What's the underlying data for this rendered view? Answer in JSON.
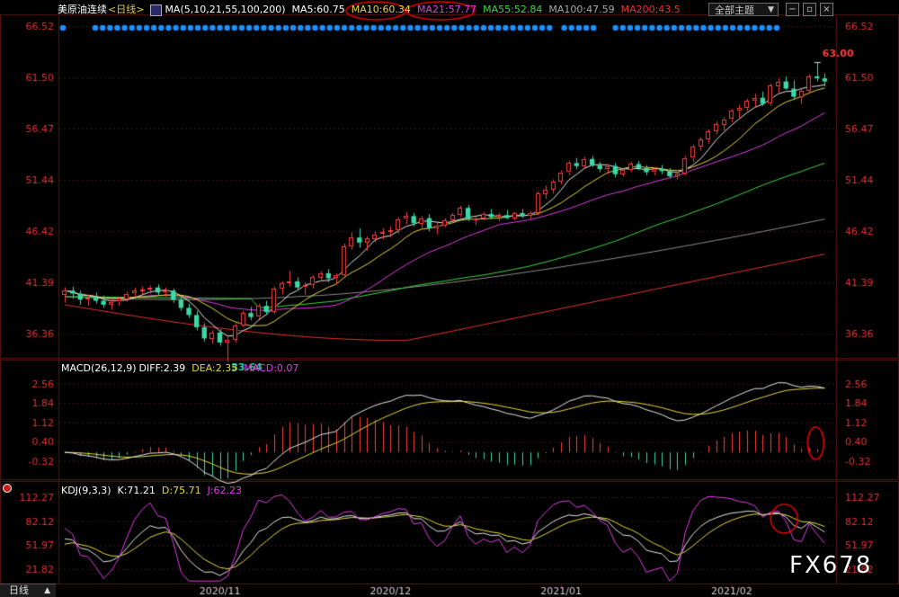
{
  "header": {
    "symbol": "美原油连续",
    "period": "<日线>",
    "ma_group": "MA(5,10,21,55,100,200)",
    "ma5": "MA5:60.75",
    "ma10": "MA10:60.34",
    "ma21": "MA21:57.77",
    "ma55": "MA55:52.84",
    "ma100": "MA100:47.59",
    "ma200": "MA200:43.5",
    "theme_label": "全部主题",
    "theme_arrow": "▼"
  },
  "macd_header": {
    "name": "MACD(26,12,9)",
    "diff": "DIFF:2.39",
    "dea": "DEA:2.35",
    "macd": "MACD:0.07"
  },
  "kdj_header": {
    "name": "KDJ(9,3,3)",
    "k": "K:71.21",
    "d": "D:75.71",
    "j": "J:62.23"
  },
  "footer": {
    "period_tab": "日线",
    "period_arrow": "▲"
  },
  "watermark": "FX678",
  "colors": {
    "up": "#ff3c3c",
    "down": "#3cd8a8",
    "ma5": "#e6e6e6",
    "ma10": "#e6d83c",
    "ma21": "#e03ce6",
    "ma55": "#3cd83c",
    "ma100": "#8c8c8c",
    "ma200": "#e6322e",
    "axis_text": "#e6322e",
    "annotation": "#e00000"
  },
  "chart_data": [
    {
      "type": "candlestick",
      "name": "美原油连续",
      "x_ticks": [
        "2020/11",
        "2020/12",
        "2021/01",
        "2021/02"
      ],
      "y_ticks": [
        "66.52",
        "61.50",
        "56.47",
        "51.44",
        "46.42",
        "41.39",
        "36.36"
      ],
      "ylim": [
        34.0,
        67.5
      ],
      "high_label": "63.00",
      "low_label": "33.64",
      "candles": [
        [
          40.2,
          40.9,
          39.4,
          40.6
        ],
        [
          40.6,
          41.0,
          39.8,
          40.3
        ],
        [
          40.3,
          40.6,
          39.2,
          39.7
        ],
        [
          39.7,
          40.2,
          39.1,
          39.9
        ],
        [
          39.9,
          40.4,
          39.3,
          39.6
        ],
        [
          39.6,
          40.1,
          38.9,
          39.2
        ],
        [
          39.2,
          39.8,
          38.7,
          39.5
        ],
        [
          39.5,
          40.0,
          39.1,
          39.8
        ],
        [
          39.8,
          40.5,
          39.5,
          40.3
        ],
        [
          40.3,
          40.9,
          40.0,
          40.6
        ],
        [
          40.6,
          41.0,
          40.2,
          40.7
        ],
        [
          40.7,
          41.1,
          40.3,
          40.9
        ],
        [
          40.9,
          41.2,
          40.1,
          40.4
        ],
        [
          40.4,
          40.9,
          40.0,
          40.6
        ],
        [
          40.6,
          40.8,
          39.4,
          39.7
        ],
        [
          39.7,
          40.0,
          38.6,
          38.9
        ],
        [
          38.9,
          39.3,
          37.9,
          38.2
        ],
        [
          38.2,
          38.6,
          36.7,
          37.0
        ],
        [
          37.0,
          37.4,
          35.6,
          35.9
        ],
        [
          35.9,
          36.7,
          35.4,
          36.5
        ],
        [
          36.5,
          36.8,
          35.2,
          35.5
        ],
        [
          35.5,
          36.1,
          33.64,
          35.8
        ],
        [
          35.8,
          37.4,
          35.5,
          37.2
        ],
        [
          37.2,
          38.6,
          37.0,
          38.4
        ],
        [
          38.4,
          39.0,
          37.7,
          38.0
        ],
        [
          38.0,
          39.3,
          37.8,
          39.1
        ],
        [
          39.1,
          39.6,
          38.2,
          38.5
        ],
        [
          38.5,
          41.0,
          38.3,
          40.8
        ],
        [
          40.8,
          41.5,
          40.2,
          41.3
        ],
        [
          41.3,
          42.5,
          41.0,
          41.5
        ],
        [
          41.5,
          41.9,
          40.6,
          40.9
        ],
        [
          40.9,
          41.4,
          40.2,
          41.1
        ],
        [
          41.1,
          42.1,
          40.8,
          41.9
        ],
        [
          41.9,
          42.5,
          41.5,
          42.3
        ],
        [
          42.3,
          42.7,
          41.4,
          41.8
        ],
        [
          41.8,
          42.3,
          41.3,
          42.1
        ],
        [
          42.1,
          45.2,
          42.0,
          44.9
        ],
        [
          44.9,
          46.3,
          44.6,
          45.8
        ],
        [
          45.8,
          46.7,
          44.8,
          45.3
        ],
        [
          45.3,
          45.9,
          44.5,
          45.7
        ],
        [
          45.7,
          46.4,
          45.3,
          46.1
        ],
        [
          46.1,
          46.7,
          45.6,
          46.3
        ],
        [
          46.3,
          46.9,
          45.8,
          46.5
        ],
        [
          46.5,
          47.8,
          46.2,
          47.6
        ],
        [
          47.6,
          48.3,
          47.1,
          47.9
        ],
        [
          47.9,
          48.2,
          46.9,
          47.2
        ],
        [
          47.2,
          47.9,
          46.7,
          47.7
        ],
        [
          47.7,
          48.1,
          46.4,
          46.7
        ],
        [
          46.7,
          47.2,
          46.1,
          47.0
        ],
        [
          47.0,
          47.7,
          46.8,
          47.5
        ],
        [
          47.5,
          48.2,
          47.3,
          48.0
        ],
        [
          48.0,
          48.9,
          47.8,
          48.7
        ],
        [
          48.7,
          49.0,
          47.4,
          47.6
        ],
        [
          47.6,
          47.9,
          47.0,
          47.7
        ],
        [
          47.7,
          48.3,
          47.5,
          48.1
        ],
        [
          48.1,
          48.6,
          47.6,
          47.8
        ],
        [
          47.8,
          48.2,
          47.4,
          48.0
        ],
        [
          48.0,
          48.5,
          47.6,
          47.7
        ],
        [
          47.7,
          48.3,
          47.5,
          48.2
        ],
        [
          48.2,
          48.6,
          47.7,
          47.9
        ],
        [
          47.9,
          48.4,
          47.6,
          48.2
        ],
        [
          48.2,
          50.3,
          48.0,
          50.1
        ],
        [
          50.1,
          50.9,
          49.6,
          50.5
        ],
        [
          50.5,
          51.5,
          50.1,
          51.3
        ],
        [
          51.3,
          52.4,
          51.0,
          52.2
        ],
        [
          52.2,
          53.3,
          51.9,
          53.1
        ],
        [
          53.1,
          53.6,
          52.5,
          52.8
        ],
        [
          52.8,
          53.7,
          52.6,
          53.5
        ],
        [
          53.5,
          53.8,
          52.7,
          52.9
        ],
        [
          52.9,
          53.2,
          52.2,
          52.5
        ],
        [
          52.5,
          53.0,
          52.0,
          52.8
        ],
        [
          52.8,
          53.1,
          51.7,
          52.0
        ],
        [
          52.0,
          52.6,
          51.8,
          52.4
        ],
        [
          52.4,
          53.2,
          52.2,
          53.0
        ],
        [
          53.0,
          53.3,
          52.4,
          52.6
        ],
        [
          52.6,
          52.9,
          51.9,
          52.2
        ],
        [
          52.2,
          52.7,
          51.9,
          52.5
        ],
        [
          52.5,
          52.9,
          52.0,
          52.3
        ],
        [
          52.3,
          52.6,
          51.6,
          51.8
        ],
        [
          51.8,
          52.2,
          51.5,
          52.1
        ],
        [
          52.1,
          53.8,
          51.9,
          53.6
        ],
        [
          53.6,
          54.9,
          53.2,
          54.7
        ],
        [
          54.7,
          55.6,
          54.3,
          55.4
        ],
        [
          55.4,
          56.4,
          55.0,
          56.2
        ],
        [
          56.2,
          57.2,
          55.9,
          56.9
        ],
        [
          56.9,
          57.6,
          56.3,
          57.4
        ],
        [
          57.4,
          58.4,
          57.1,
          58.2
        ],
        [
          58.2,
          58.8,
          57.5,
          58.5
        ],
        [
          58.5,
          59.4,
          58.2,
          59.2
        ],
        [
          59.2,
          59.9,
          58.6,
          59.5
        ],
        [
          59.5,
          60.1,
          58.7,
          58.9
        ],
        [
          58.9,
          60.9,
          58.7,
          60.7
        ],
        [
          60.7,
          61.4,
          60.0,
          61.1
        ],
        [
          61.1,
          61.6,
          60.3,
          60.4
        ],
        [
          60.4,
          61.2,
          59.3,
          59.6
        ],
        [
          59.6,
          60.4,
          58.9,
          60.2
        ],
        [
          60.2,
          61.8,
          59.9,
          61.6
        ],
        [
          61.6,
          63.0,
          61.1,
          61.4
        ],
        [
          61.4,
          61.9,
          60.6,
          61.1
        ]
      ]
    },
    {
      "type": "bar",
      "name": "MACD(26,12,9)",
      "y_ticks": [
        "2.56",
        "1.84",
        "1.12",
        "0.40",
        "-0.32"
      ],
      "ylim": [
        -0.9,
        2.85
      ],
      "diff": 2.39,
      "dea": 2.35,
      "macd": 0.07
    },
    {
      "type": "line",
      "name": "KDJ(9,3,3)",
      "y_ticks": [
        "112.27",
        "82.12",
        "51.97",
        "21.82"
      ],
      "ylim": [
        5,
        118
      ],
      "k": 71.21,
      "d": 75.71,
      "j": 62.23
    }
  ]
}
